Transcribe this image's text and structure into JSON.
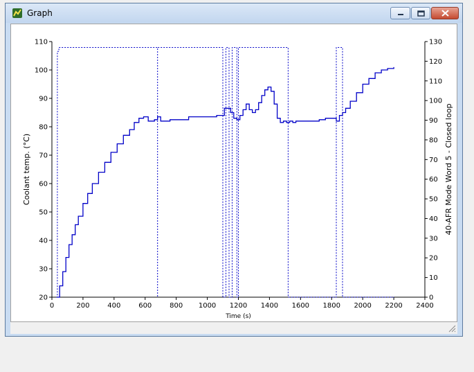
{
  "window": {
    "title": "Graph"
  },
  "colors": {
    "trace": "#0000c8",
    "axis": "#000000",
    "window_frame": "#c9dcf2",
    "close": "#c54a30"
  },
  "chart_data": {
    "type": "line",
    "xlabel": "Time (s)",
    "ylabel_left": "Coolant temp. (°C)",
    "ylabel_right": "40-AFR Mode Word 5 - Closed loop",
    "xlim": [
      0,
      2400
    ],
    "ylim_left": [
      20,
      110
    ],
    "ylim_right": [
      0,
      130
    ],
    "x_ticks": [
      0,
      200,
      400,
      600,
      800,
      1000,
      1200,
      1400,
      1600,
      1800,
      2000,
      2200,
      2400
    ],
    "y_ticks_left": [
      20,
      30,
      40,
      50,
      60,
      70,
      80,
      90,
      100,
      110
    ],
    "y_ticks_right": [
      0,
      10,
      20,
      30,
      40,
      50,
      60,
      70,
      80,
      90,
      100,
      110,
      120,
      130
    ],
    "series": [
      {
        "axis": "left",
        "style": "solid",
        "x": [
          30,
          50,
          70,
          90,
          110,
          130,
          150,
          170,
          200,
          230,
          260,
          300,
          340,
          380,
          420,
          460,
          500,
          530,
          560,
          590,
          600,
          620,
          640,
          660,
          680,
          700,
          730,
          760,
          790,
          820,
          850,
          880,
          910,
          940,
          970,
          1000,
          1030,
          1060,
          1090,
          1110,
          1130,
          1150,
          1170,
          1190,
          1210,
          1230,
          1250,
          1270,
          1290,
          1310,
          1330,
          1350,
          1370,
          1390,
          1410,
          1430,
          1450,
          1470,
          1490,
          1510,
          1530,
          1550,
          1570,
          1600,
          1640,
          1680,
          1720,
          1760,
          1800,
          1830,
          1850,
          1870,
          1890,
          1920,
          1960,
          2000,
          2040,
          2080,
          2120,
          2160,
          2200
        ],
        "y": [
          20,
          24,
          29,
          34,
          38.5,
          42,
          45.5,
          48.5,
          53,
          56.5,
          60,
          64,
          67.5,
          71,
          74,
          77,
          79,
          81.5,
          83,
          83.5,
          83.5,
          82,
          82,
          82.5,
          83.5,
          82,
          82,
          82.5,
          82.5,
          82.5,
          82.5,
          83.5,
          83.5,
          83.5,
          83.5,
          83.5,
          83.5,
          84,
          84,
          86.5,
          86.5,
          85,
          83,
          82.5,
          84,
          86,
          88,
          86,
          85,
          86,
          88.5,
          91,
          93,
          94,
          92.5,
          88,
          83,
          81.5,
          82,
          81.5,
          82,
          81.5,
          82,
          82,
          82,
          82,
          82.5,
          83,
          83,
          82,
          84,
          85,
          86.5,
          89,
          92,
          95,
          97,
          99,
          100,
          100.5,
          101
        ]
      },
      {
        "axis": "right",
        "style": "dashed",
        "x": [
          30,
          35,
          35,
          45,
          45,
          680,
          680,
          680,
          1100,
          1100,
          1120,
          1120,
          1140,
          1140,
          1160,
          1160,
          1190,
          1190,
          1200,
          1200,
          1520,
          1520,
          1830,
          1830,
          1870,
          1870,
          2200
        ],
        "y": [
          0,
          0,
          125,
          125,
          127,
          127,
          0,
          127,
          127,
          0,
          0,
          127,
          127,
          0,
          0,
          127,
          127,
          0,
          0,
          127,
          127,
          0,
          0,
          127,
          127,
          0,
          0
        ]
      }
    ]
  }
}
